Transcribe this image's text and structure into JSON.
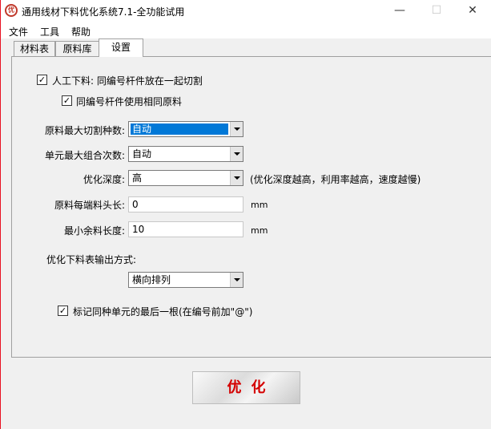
{
  "window": {
    "title": "通用线材下料优化系统7.1-全功能试用",
    "icon_text": "优",
    "controls": {
      "minimize": "—",
      "maximize": "☐",
      "close": "✕"
    }
  },
  "menu": [
    "文件",
    "工具",
    "帮助"
  ],
  "tabs": [
    {
      "label": "材料表",
      "active": false
    },
    {
      "label": "原料库",
      "active": false
    },
    {
      "label": "设置",
      "active": true
    }
  ],
  "settings": {
    "manual_cut": {
      "checked": true,
      "mark": "✓",
      "label": "人工下料:  同编号杆件放在一起切割"
    },
    "same_material": {
      "checked": true,
      "mark": "✓",
      "label": "同编号杆件使用相同原料"
    },
    "max_cut_types": {
      "label": "原料最大切割种数:",
      "value": "自动"
    },
    "max_combinations": {
      "label": "单元最大组合次数:",
      "value": "自动"
    },
    "optimization_depth": {
      "label": "优化深度:",
      "value": "高",
      "hint": "(优化深度越高，利用率越高，速度越慢)"
    },
    "end_waste": {
      "label": "原料每端料头长:",
      "value": "0",
      "unit": "mm"
    },
    "min_remnant": {
      "label": "最小余料长度:",
      "value": "10",
      "unit": "mm"
    },
    "output_mode": {
      "label": "优化下料表输出方式:",
      "value": "横向排列"
    },
    "mark_last": {
      "checked": true,
      "mark": "✓",
      "label": "标记同种单元的最后一根(在编号前加\"@\")"
    }
  },
  "optimize_button": "优化"
}
